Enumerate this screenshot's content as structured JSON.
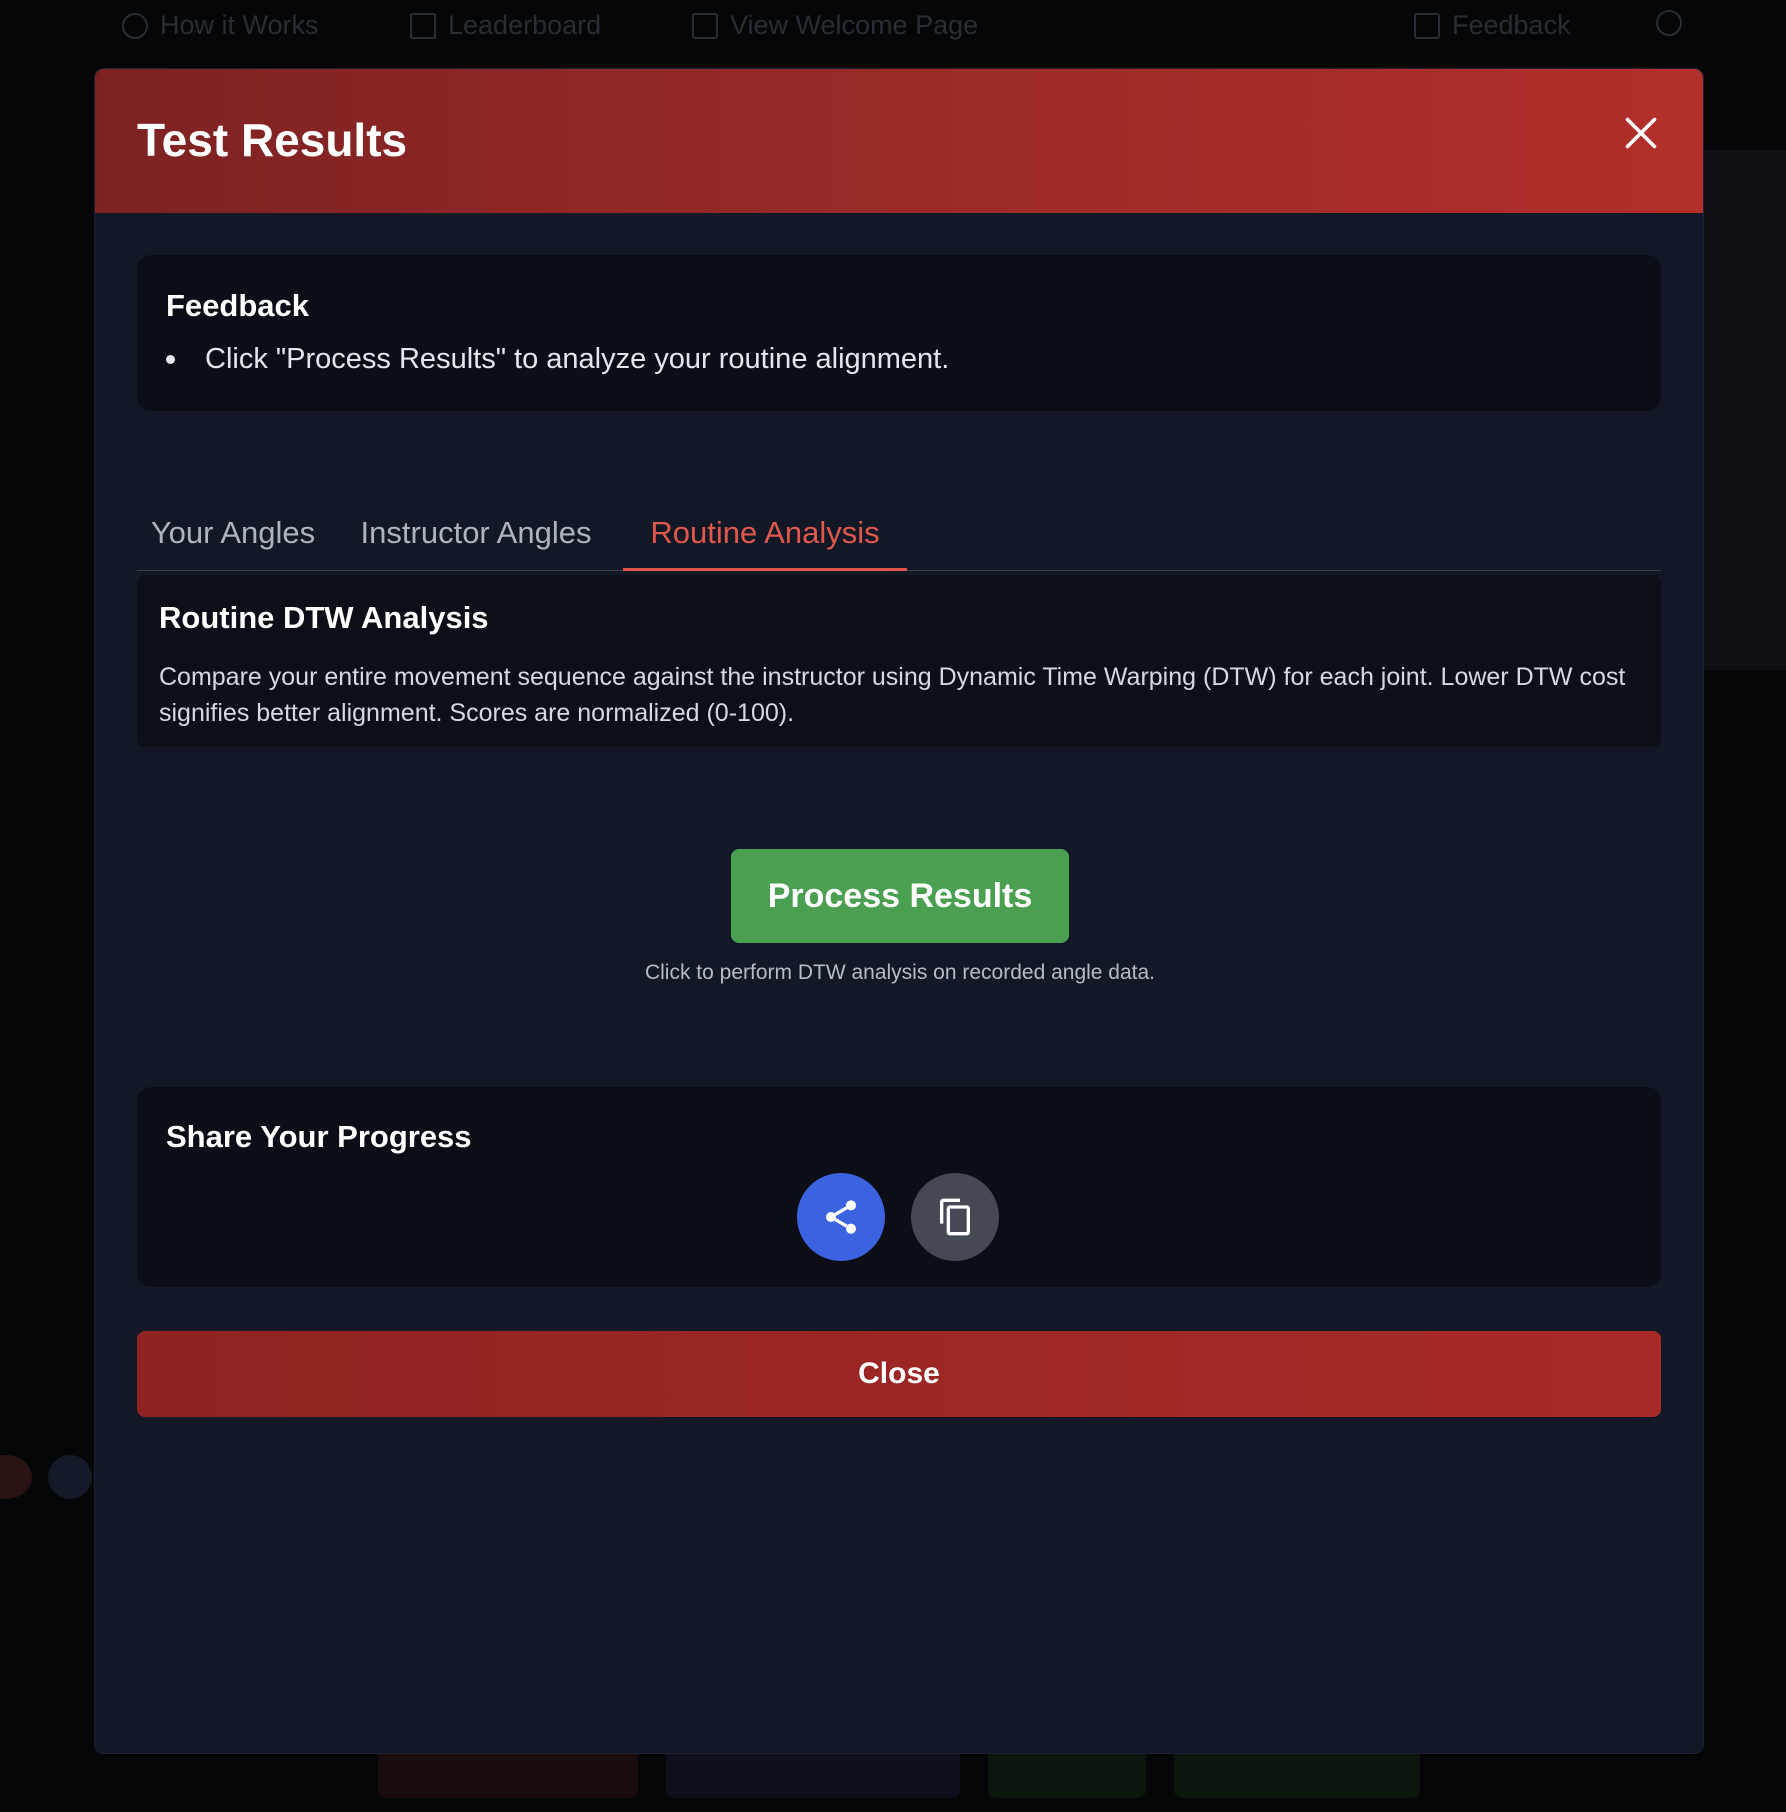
{
  "background": {
    "nav": {
      "how_it_works": "How it Works",
      "leaderboard": "Leaderboard",
      "welcome": "View Welcome Page",
      "feedback": "Feedback"
    }
  },
  "modal": {
    "title": "Test Results",
    "feedback": {
      "title": "Feedback",
      "items": [
        "Click \"Process Results\" to analyze your routine alignment."
      ]
    },
    "tabs": [
      {
        "label": "Your Angles",
        "active": false
      },
      {
        "label": "Instructor Angles",
        "active": false
      },
      {
        "label": "Routine Analysis",
        "active": true
      }
    ],
    "analysis": {
      "title": "Routine DTW Analysis",
      "description": "Compare your entire movement sequence against the instructor using Dynamic Time Warping (DTW) for each joint. Lower DTW cost signifies better alignment. Scores are normalized (0-100).",
      "process_button": "Process Results",
      "process_hint": "Click to perform DTW analysis on recorded angle data."
    },
    "share": {
      "title": "Share Your Progress",
      "share_icon": "share-icon",
      "copy_icon": "copy-icon"
    },
    "close_button": "Close"
  },
  "colors": {
    "header_start": "#7d2222",
    "header_end": "#b32f2a",
    "active_tab": "#e0574c",
    "process_green": "#4aa050",
    "share_blue": "#3b63e0",
    "close_red": "#a72a27"
  }
}
